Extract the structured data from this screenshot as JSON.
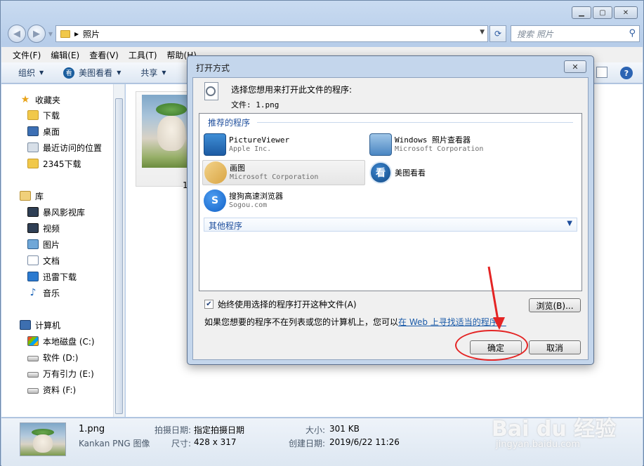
{
  "explorer": {
    "address_path": "照片",
    "search_placeholder": "搜索 照片",
    "menu": [
      "文件(F)",
      "编辑(E)",
      "查看(V)",
      "工具(T)",
      "帮助(H)"
    ],
    "toolbar": {
      "organize": "组织",
      "open_with": "美图看看",
      "share": "共享",
      "kk_icon_label": "看"
    },
    "sidebar": {
      "favorites": "收藏夹",
      "favorites_items": [
        "下载",
        "桌面",
        "最近访问的位置",
        "2345下载"
      ],
      "libraries": "库",
      "library_items": [
        "暴风影视库",
        "视频",
        "图片",
        "文档",
        "迅雷下载",
        "音乐"
      ],
      "computer": "计算机",
      "computer_items": [
        "本地磁盘 (C:)",
        "软件 (D:)",
        "万有引力 (E:)",
        "资料 (F:)"
      ]
    },
    "content": {
      "thumbnail_label": "1"
    },
    "details": {
      "filename": "1.png",
      "filetype": "Kankan PNG 图像",
      "date_taken_key": "拍摄日期:",
      "date_taken_value": "指定拍摄日期",
      "dimensions_key": "尺寸:",
      "dimensions_value": "428 x 317",
      "size_key": "大小:",
      "size_value": "301 KB",
      "created_key": "创建日期:",
      "created_value": "2019/6/22 11:26"
    }
  },
  "dialog": {
    "title": "打开方式",
    "prompt": "选择您想用来打开此文件的程序:",
    "file_line": "文件:  1.png",
    "recommended_header": "推荐的程序",
    "programs": [
      {
        "name": "PictureViewer",
        "publisher": "Apple Inc.",
        "icon": "picture-viewer-icon"
      },
      {
        "name": "Windows 照片查看器",
        "publisher": "Microsoft Corporation",
        "icon": "windows-photo-viewer-icon"
      },
      {
        "name": "画图",
        "publisher": "Microsoft Corporation",
        "icon": "paint-icon"
      },
      {
        "name": "美图看看",
        "publisher": "",
        "icon": "kankan-icon"
      },
      {
        "name": "搜狗高速浏览器",
        "publisher": "Sogou.com",
        "icon": "sogou-browser-icon"
      }
    ],
    "kk_glyph": "看",
    "other_header": "其他程序",
    "always_use_label": "始终使用选择的程序打开这种文件(A)",
    "always_use_checked": true,
    "browse_label": "浏览(B)...",
    "info_text": "如果您想要的程序不在列表或您的计算机上，您可以",
    "info_link": "在 Web 上寻找适当的程序。",
    "ok_label": "确定",
    "cancel_label": "取消"
  },
  "watermark": {
    "main": "Bai du 经验",
    "sub": "jingyan.baidu.com"
  },
  "colors": {
    "accent_red": "#e42424",
    "link_blue": "#1a5aa8",
    "group_header": "#1e4e9c"
  }
}
